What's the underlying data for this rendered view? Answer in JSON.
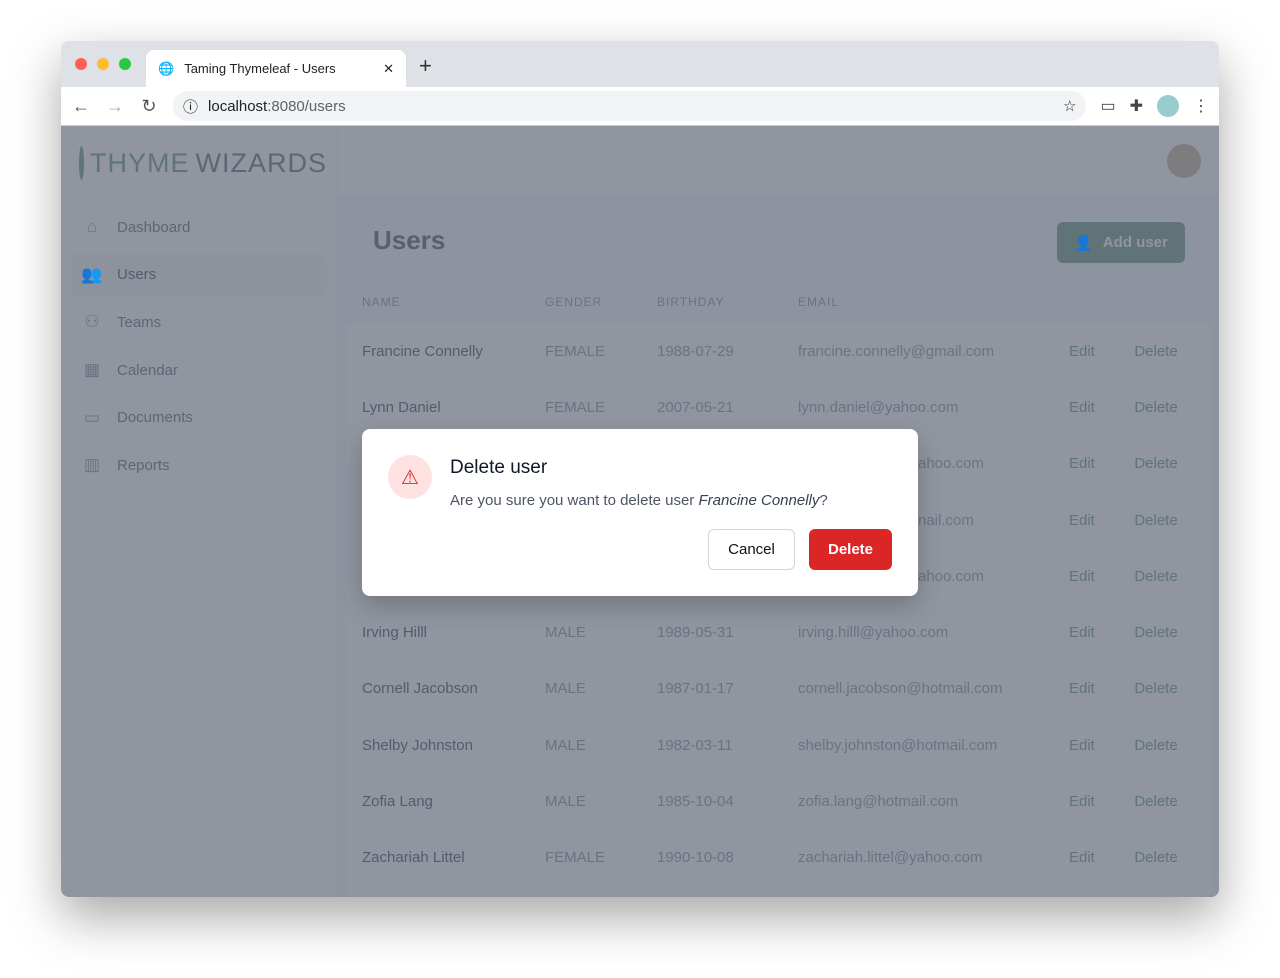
{
  "browser": {
    "tab_title": "Taming Thymeleaf - Users",
    "url_host": "localhost",
    "url_path": ":8080/users"
  },
  "app": {
    "logo_a": "THYME",
    "logo_b": "WIZARDS",
    "sidebar": [
      {
        "label": "Dashboard",
        "icon": "⌂"
      },
      {
        "label": "Users",
        "icon": "👥"
      },
      {
        "label": "Teams",
        "icon": "⚇"
      },
      {
        "label": "Calendar",
        "icon": "▦"
      },
      {
        "label": "Documents",
        "icon": "▭"
      },
      {
        "label": "Reports",
        "icon": "▥"
      }
    ],
    "page_title": "Users",
    "add_user": "Add user",
    "columns": [
      "NAME",
      "GENDER",
      "BIRTHDAY",
      "EMAIL"
    ],
    "edit": "Edit",
    "delete": "Delete",
    "rows": [
      {
        "name": "Francine Connelly",
        "gender": "FEMALE",
        "birthday": "1988-07-29",
        "email": "francine.connelly@gmail.com"
      },
      {
        "name": "Lynn Daniel",
        "gender": "FEMALE",
        "birthday": "2007-05-21",
        "email": "lynn.daniel@yahoo.com"
      },
      {
        "name": "",
        "gender": "",
        "birthday": "",
        "email": "ahoo.com"
      },
      {
        "name": "",
        "gender": "",
        "birthday": "",
        "email": "nail.com"
      },
      {
        "name": "",
        "gender": "",
        "birthday": "",
        "email": "ahoo.com"
      },
      {
        "name": "Irving Hilll",
        "gender": "MALE",
        "birthday": "1989-05-31",
        "email": "irving.hilll@yahoo.com"
      },
      {
        "name": "Cornell Jacobson",
        "gender": "MALE",
        "birthday": "1987-01-17",
        "email": "cornell.jacobson@hotmail.com"
      },
      {
        "name": "Shelby Johnston",
        "gender": "MALE",
        "birthday": "1982-03-11",
        "email": "shelby.johnston@hotmail.com"
      },
      {
        "name": "Zofia Lang",
        "gender": "MALE",
        "birthday": "1985-10-04",
        "email": "zofia.lang@hotmail.com"
      },
      {
        "name": "Zachariah Littel",
        "gender": "FEMALE",
        "birthday": "1990-10-08",
        "email": "zachariah.littel@yahoo.com"
      }
    ]
  },
  "modal": {
    "title": "Delete user",
    "text": "Are you sure you want to delete user ",
    "user": "Francine Connelly",
    "suffix": "?",
    "cancel": "Cancel",
    "delete": "Delete"
  }
}
